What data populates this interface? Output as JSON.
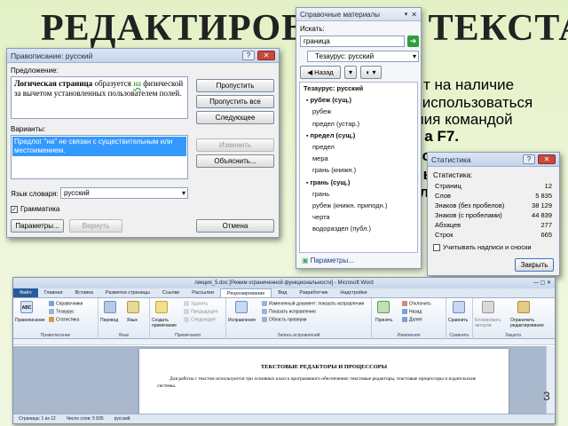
{
  "slide": {
    "title": "РЕДАКТИРОВАНИЕ ТЕКСТА",
    "body_lines": [
      {
        "pre": "ри",
        "bold": "",
        "post": "т на наличие"
      },
      {
        "pre": "т",
        "bold": "",
        "post": "использоваться"
      },
      {
        "pre": "ве",
        "bold": "",
        "post": "ния командой"
      },
      {
        "pre": "н",
        "bold": "",
        "post": "а F7."
      },
      {
        "pre": "в",
        "bold": "",
        "post": "о"
      },
      {
        "pre": "но",
        "bold": "",
        "post": "ым"
      },
      {
        "pre": "и",
        "bold": "",
        "post": "ла"
      }
    ],
    "page_number": "3"
  },
  "spelling": {
    "title": "Правописание: русский",
    "sentence_label": "Предложение:",
    "sentence_bold": "Логическая страница",
    "sentence_rest1": " образуется ",
    "sentence_error": "на",
    "sentence_rest2": " физической за вычетом установленных пользователем полей.",
    "variants_label": "Варианты:",
    "variant_text": "Предлог \"на\" не связан с существительным или местоимением.",
    "skip_button": "Пропустить",
    "skip_all_button": "Пропустить все",
    "next_button": "Следующее",
    "change_button": "Изменить",
    "explain_button": "Объяснить...",
    "language_label": "Язык словаря:",
    "language_value": "русский",
    "grammar_label": "Грамматика",
    "params_button": "Параметры...",
    "undo_button": "Вернуть",
    "cancel_button": "Отмена"
  },
  "reference": {
    "title": "Справочные материалы",
    "search_label": "Искать:",
    "search_value": "граница",
    "source_value": "Тезаурус: русский",
    "back_button": "Назад",
    "list_items": [
      {
        "text": "Тезаурус: русский",
        "kind": "head"
      },
      {
        "text": "рубеж (сущ.)",
        "kind": "group"
      },
      {
        "text": "рубеж",
        "kind": "item"
      },
      {
        "text": "предел (устар.)",
        "kind": "item"
      },
      {
        "text": "предел (сущ.)",
        "kind": "group"
      },
      {
        "text": "предел",
        "kind": "item"
      },
      {
        "text": "мера",
        "kind": "item"
      },
      {
        "text": "грань (книжн.)",
        "kind": "item"
      },
      {
        "text": "грань (сущ.)",
        "kind": "group"
      },
      {
        "text": "грань",
        "kind": "item"
      },
      {
        "text": "рубеж (книжн. приподн.)",
        "kind": "item"
      },
      {
        "text": "черта",
        "kind": "item"
      },
      {
        "text": "водораздел (публ.)",
        "kind": "item"
      }
    ],
    "params_link": "Параметры..."
  },
  "stats": {
    "title": "Статистика",
    "section_label": "Статистика:",
    "rows": [
      {
        "name": "Страниц",
        "value": "12"
      },
      {
        "name": "Слов",
        "value": "5 835"
      },
      {
        "name": "Знаков (без пробелов)",
        "value": "38 129"
      },
      {
        "name": "Знаков (с пробелами)",
        "value": "44 839"
      },
      {
        "name": "Абзацев",
        "value": "277"
      },
      {
        "name": "Строк",
        "value": "665"
      }
    ],
    "checkbox_label": "Учитывать надписи и сноски",
    "close_button": "Закрыть"
  },
  "word": {
    "title": "лекция_5.doc [Режим ограниченной функциональности] - Microsoft Word",
    "tabs": [
      "Файл",
      "Главная",
      "Вставка",
      "Разметка страницы",
      "Ссылки",
      "Рассылки",
      "Рецензирование",
      "Вид",
      "Разработчик",
      "Надстройки"
    ],
    "ribbon": {
      "spell": "Правописание",
      "ref": "Справочники",
      "thes": "Тезаурус",
      "stat": "Статистика",
      "group_spell": "Правописание",
      "translate": "Перевод",
      "language": "Язык",
      "group_lang": "Язык",
      "create_note": "Создать примечание",
      "del": "Удалить",
      "prev": "Предыдущее",
      "next": "Следующее",
      "group_notes": "Примечания",
      "fix": "Исправления",
      "changed_doc": "Измененный документ: показать исправления",
      "show_fix": "Показать исправления",
      "check_area": "Область проверки",
      "group_track": "Запись исправлений",
      "accept": "Принять",
      "reject": "Отклонить",
      "back": "Назад",
      "further": "Далее",
      "group_changes": "Изменения",
      "compare": "Сравнить",
      "group_compare": "Сравнить",
      "block_authors": "Блокировать авторов",
      "restrict": "Ограничить редактирование",
      "group_protect": "Защита"
    },
    "doc_heading": "ТЕКСТОВЫЕ РЕДАКТОРЫ И ПРОЦЕССОРЫ",
    "doc_para": "Для работы с текстом используются три основных класса программного обеспечения: текстовые редакторы, текстовые процессоры и издательские системы.",
    "status_page": "Страница: 1 из 12",
    "status_words": "Число слов: 5 835",
    "status_lang": "русский"
  }
}
